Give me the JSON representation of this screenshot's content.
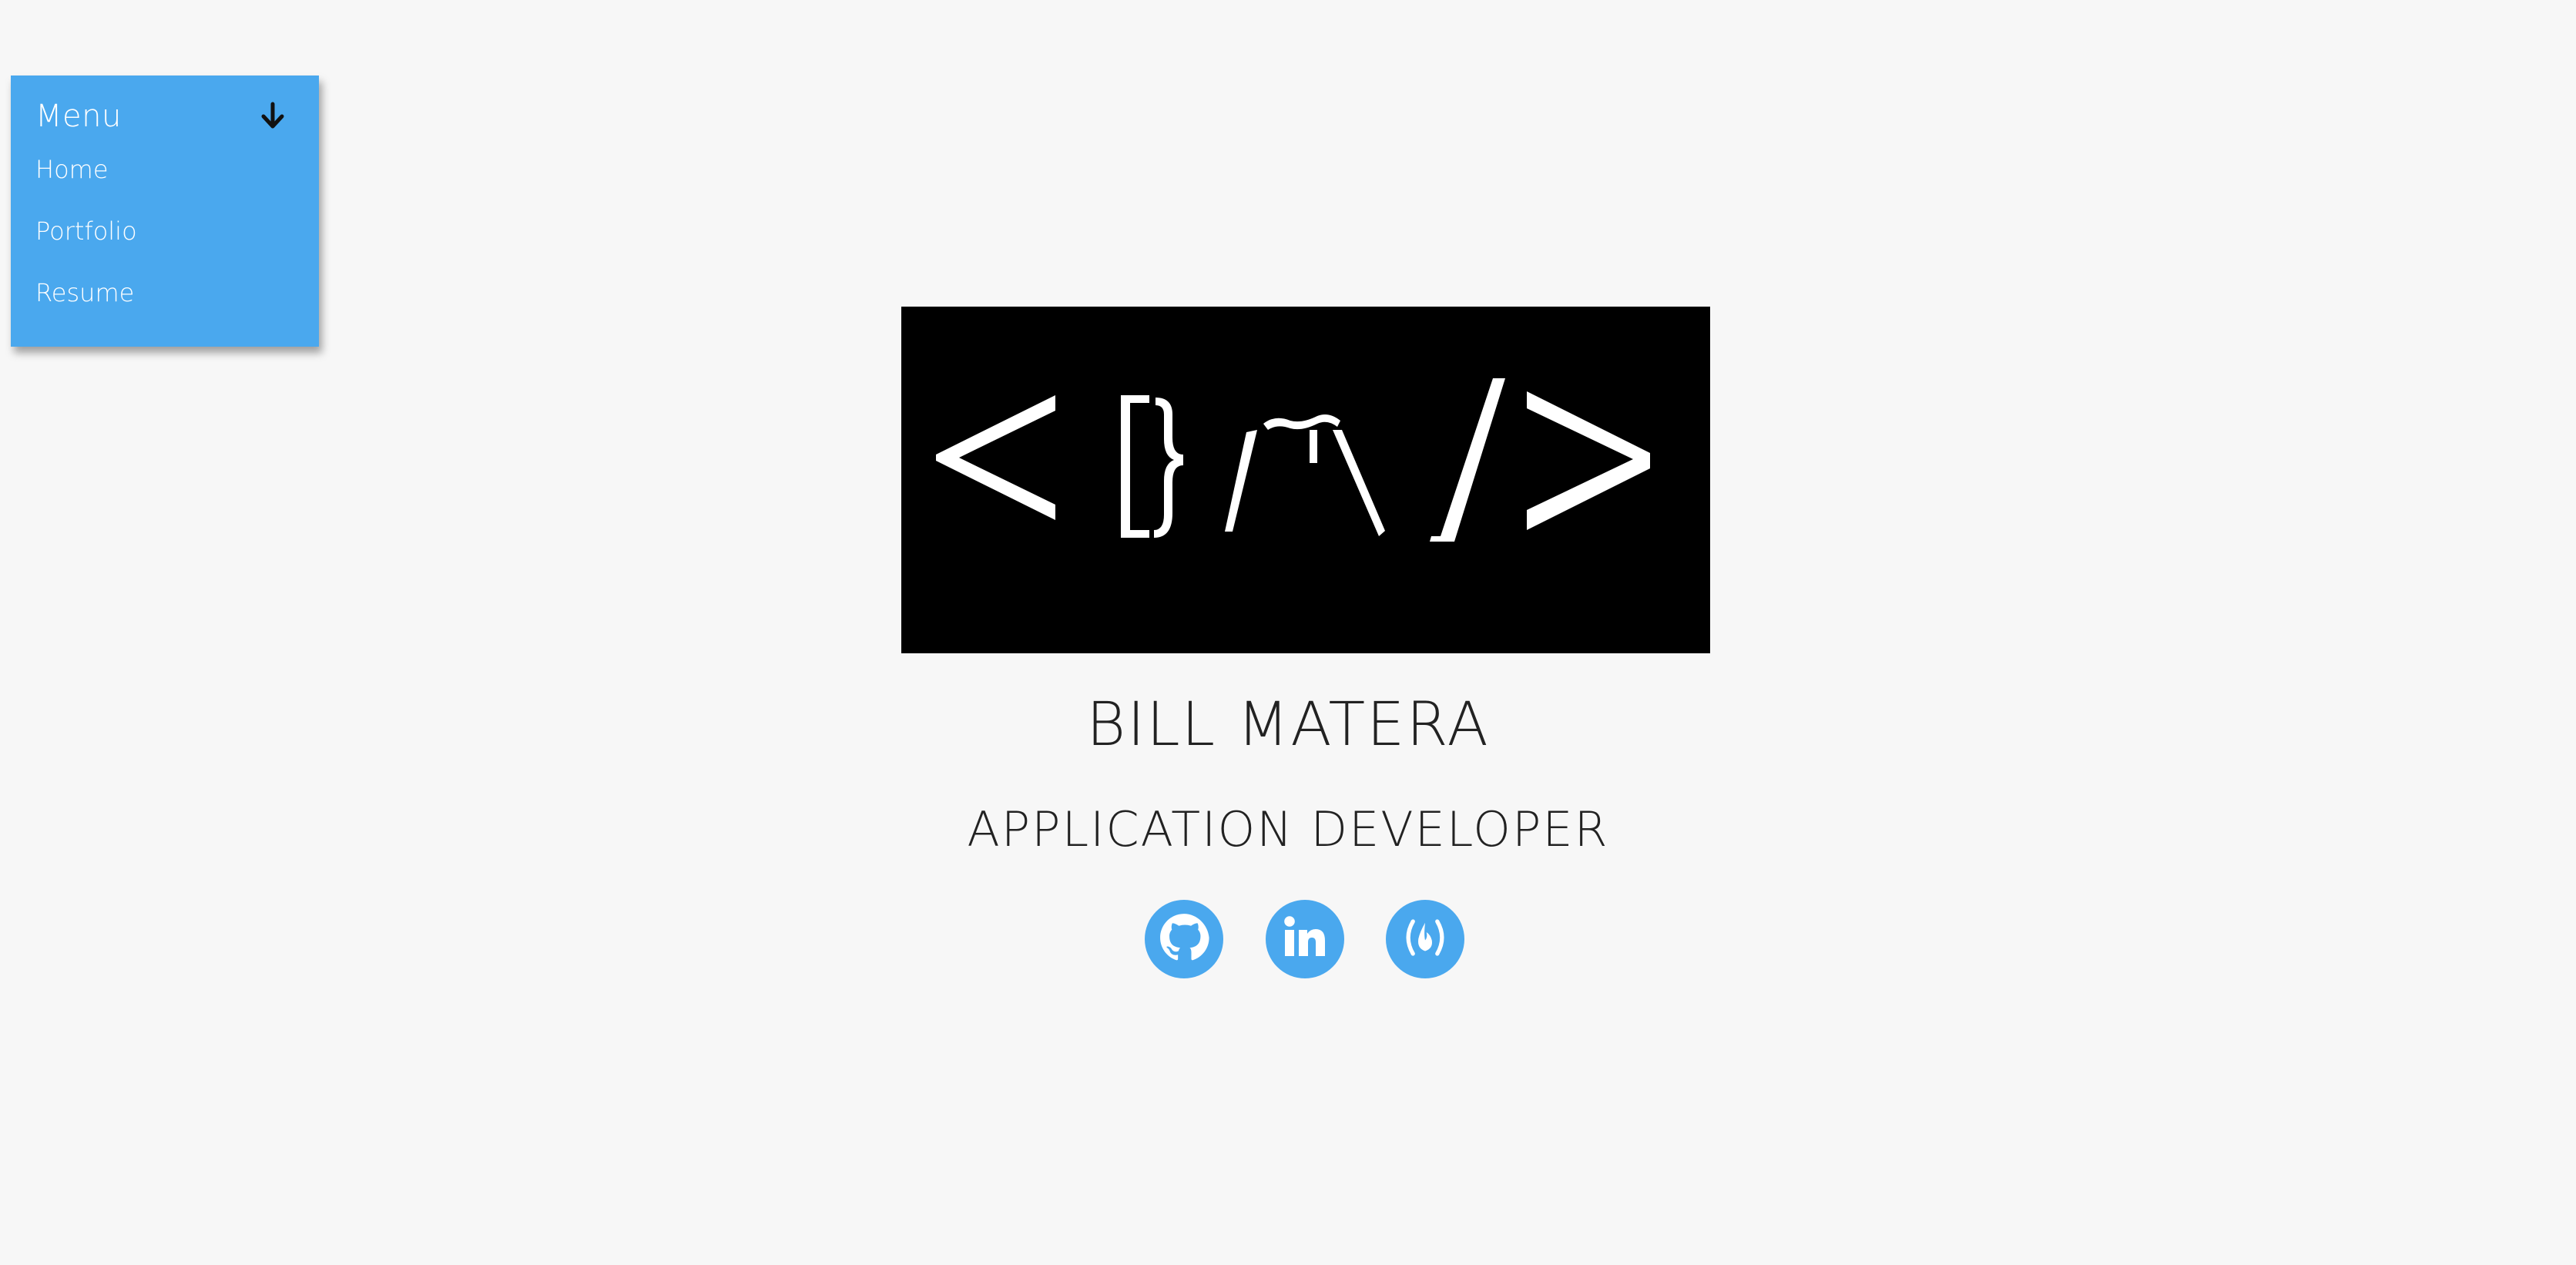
{
  "menu": {
    "title": "Menu",
    "items": [
      {
        "label": "Home"
      },
      {
        "label": "Portfolio"
      },
      {
        "label": "Resume"
      }
    ]
  },
  "hero": {
    "name": "BILL MATERA",
    "title": "APPLICATION DEVELOPER"
  },
  "social": [
    {
      "icon": "github-icon"
    },
    {
      "icon": "linkedin-icon"
    },
    {
      "icon": "freecodecamp-icon"
    }
  ],
  "colors": {
    "accent": "#4aa8ee",
    "background": "#f7f7f7",
    "logo_bg": "#000000",
    "text": "#222222"
  }
}
